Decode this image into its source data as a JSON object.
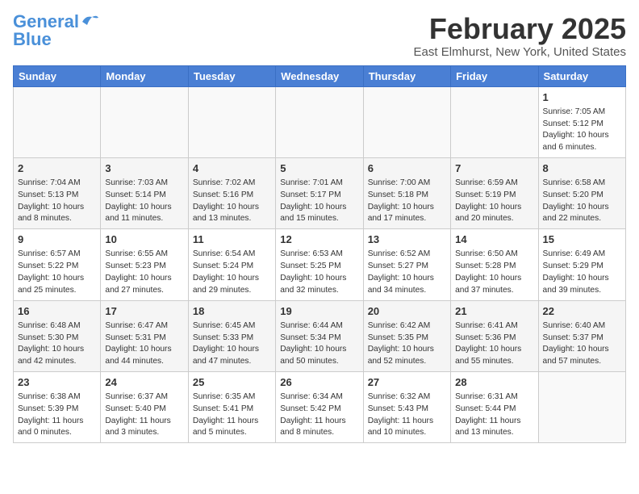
{
  "header": {
    "logo_general": "General",
    "logo_blue": "Blue",
    "title": "February 2025",
    "subtitle": "East Elmhurst, New York, United States"
  },
  "weekdays": [
    "Sunday",
    "Monday",
    "Tuesday",
    "Wednesday",
    "Thursday",
    "Friday",
    "Saturday"
  ],
  "weeks": [
    [
      {
        "day": "",
        "info": ""
      },
      {
        "day": "",
        "info": ""
      },
      {
        "day": "",
        "info": ""
      },
      {
        "day": "",
        "info": ""
      },
      {
        "day": "",
        "info": ""
      },
      {
        "day": "",
        "info": ""
      },
      {
        "day": "1",
        "info": "Sunrise: 7:05 AM\nSunset: 5:12 PM\nDaylight: 10 hours\nand 6 minutes."
      }
    ],
    [
      {
        "day": "2",
        "info": "Sunrise: 7:04 AM\nSunset: 5:13 PM\nDaylight: 10 hours\nand 8 minutes."
      },
      {
        "day": "3",
        "info": "Sunrise: 7:03 AM\nSunset: 5:14 PM\nDaylight: 10 hours\nand 11 minutes."
      },
      {
        "day": "4",
        "info": "Sunrise: 7:02 AM\nSunset: 5:16 PM\nDaylight: 10 hours\nand 13 minutes."
      },
      {
        "day": "5",
        "info": "Sunrise: 7:01 AM\nSunset: 5:17 PM\nDaylight: 10 hours\nand 15 minutes."
      },
      {
        "day": "6",
        "info": "Sunrise: 7:00 AM\nSunset: 5:18 PM\nDaylight: 10 hours\nand 17 minutes."
      },
      {
        "day": "7",
        "info": "Sunrise: 6:59 AM\nSunset: 5:19 PM\nDaylight: 10 hours\nand 20 minutes."
      },
      {
        "day": "8",
        "info": "Sunrise: 6:58 AM\nSunset: 5:20 PM\nDaylight: 10 hours\nand 22 minutes."
      }
    ],
    [
      {
        "day": "9",
        "info": "Sunrise: 6:57 AM\nSunset: 5:22 PM\nDaylight: 10 hours\nand 25 minutes."
      },
      {
        "day": "10",
        "info": "Sunrise: 6:55 AM\nSunset: 5:23 PM\nDaylight: 10 hours\nand 27 minutes."
      },
      {
        "day": "11",
        "info": "Sunrise: 6:54 AM\nSunset: 5:24 PM\nDaylight: 10 hours\nand 29 minutes."
      },
      {
        "day": "12",
        "info": "Sunrise: 6:53 AM\nSunset: 5:25 PM\nDaylight: 10 hours\nand 32 minutes."
      },
      {
        "day": "13",
        "info": "Sunrise: 6:52 AM\nSunset: 5:27 PM\nDaylight: 10 hours\nand 34 minutes."
      },
      {
        "day": "14",
        "info": "Sunrise: 6:50 AM\nSunset: 5:28 PM\nDaylight: 10 hours\nand 37 minutes."
      },
      {
        "day": "15",
        "info": "Sunrise: 6:49 AM\nSunset: 5:29 PM\nDaylight: 10 hours\nand 39 minutes."
      }
    ],
    [
      {
        "day": "16",
        "info": "Sunrise: 6:48 AM\nSunset: 5:30 PM\nDaylight: 10 hours\nand 42 minutes."
      },
      {
        "day": "17",
        "info": "Sunrise: 6:47 AM\nSunset: 5:31 PM\nDaylight: 10 hours\nand 44 minutes."
      },
      {
        "day": "18",
        "info": "Sunrise: 6:45 AM\nSunset: 5:33 PM\nDaylight: 10 hours\nand 47 minutes."
      },
      {
        "day": "19",
        "info": "Sunrise: 6:44 AM\nSunset: 5:34 PM\nDaylight: 10 hours\nand 50 minutes."
      },
      {
        "day": "20",
        "info": "Sunrise: 6:42 AM\nSunset: 5:35 PM\nDaylight: 10 hours\nand 52 minutes."
      },
      {
        "day": "21",
        "info": "Sunrise: 6:41 AM\nSunset: 5:36 PM\nDaylight: 10 hours\nand 55 minutes."
      },
      {
        "day": "22",
        "info": "Sunrise: 6:40 AM\nSunset: 5:37 PM\nDaylight: 10 hours\nand 57 minutes."
      }
    ],
    [
      {
        "day": "23",
        "info": "Sunrise: 6:38 AM\nSunset: 5:39 PM\nDaylight: 11 hours\nand 0 minutes."
      },
      {
        "day": "24",
        "info": "Sunrise: 6:37 AM\nSunset: 5:40 PM\nDaylight: 11 hours\nand 3 minutes."
      },
      {
        "day": "25",
        "info": "Sunrise: 6:35 AM\nSunset: 5:41 PM\nDaylight: 11 hours\nand 5 minutes."
      },
      {
        "day": "26",
        "info": "Sunrise: 6:34 AM\nSunset: 5:42 PM\nDaylight: 11 hours\nand 8 minutes."
      },
      {
        "day": "27",
        "info": "Sunrise: 6:32 AM\nSunset: 5:43 PM\nDaylight: 11 hours\nand 10 minutes."
      },
      {
        "day": "28",
        "info": "Sunrise: 6:31 AM\nSunset: 5:44 PM\nDaylight: 11 hours\nand 13 minutes."
      },
      {
        "day": "",
        "info": ""
      }
    ]
  ]
}
